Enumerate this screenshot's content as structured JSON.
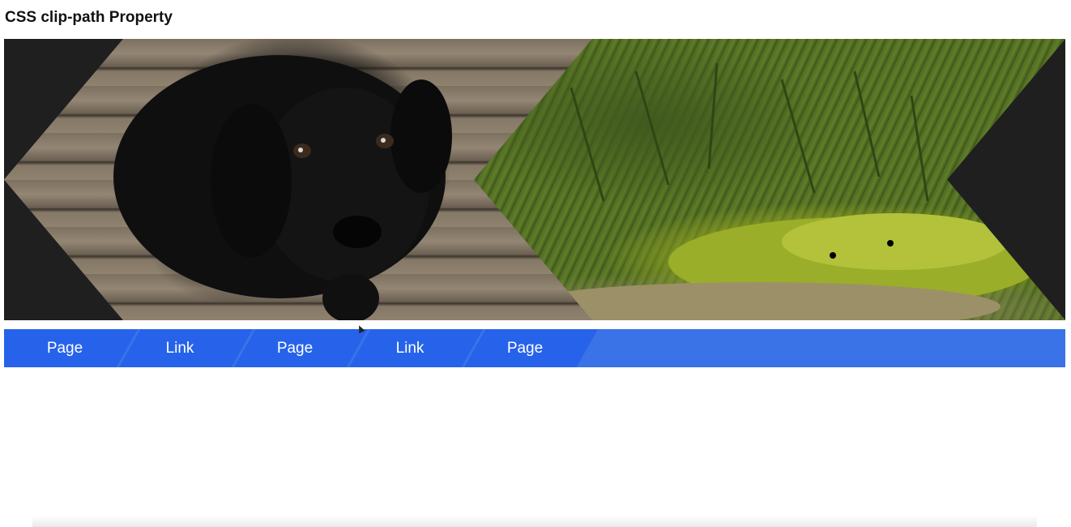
{
  "page": {
    "title": "CSS clip-path Property"
  },
  "hero": {
    "left_image_label": "black-puppy-photo",
    "right_image_label": "moss-forest-photo",
    "panel_color": "#1f1f1f"
  },
  "nav": {
    "background_color": "#3a72e8",
    "item_color": "#2663ea",
    "items": [
      {
        "label": "Page"
      },
      {
        "label": "Link"
      },
      {
        "label": "Page"
      },
      {
        "label": "Link"
      },
      {
        "label": "Page"
      }
    ]
  }
}
